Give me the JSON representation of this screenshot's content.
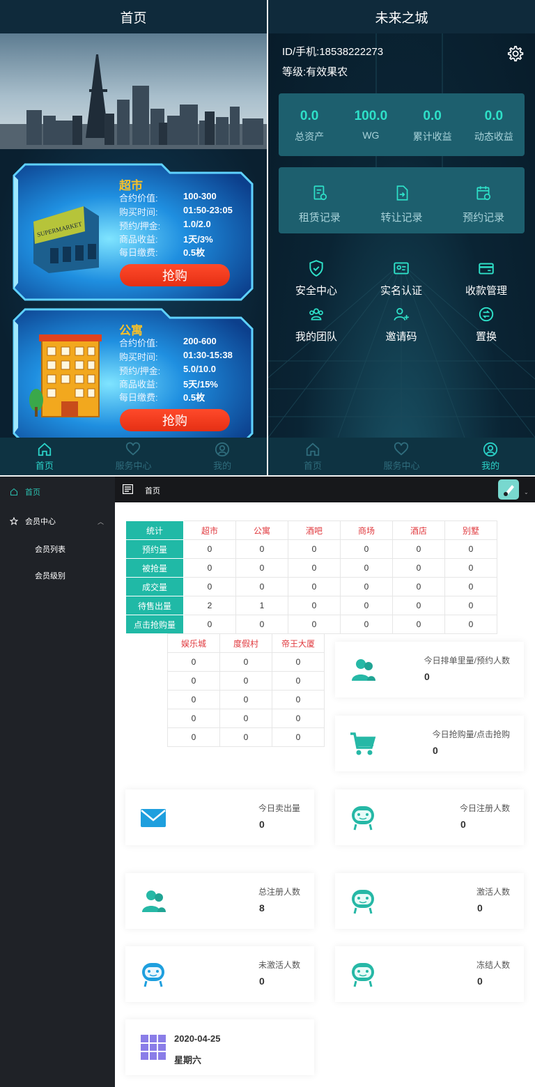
{
  "left_phone": {
    "title": "首页",
    "cards": [
      {
        "title": "超市",
        "sign_text": "SUPERMARKET",
        "rows": [
          {
            "k": "合约价值:",
            "v": "100-300"
          },
          {
            "k": "购买时间:",
            "v": "01:50-23:05"
          },
          {
            "k": "预约/押金:",
            "v": "1.0/2.0"
          },
          {
            "k": "商品收益:",
            "v": "1天/3%"
          },
          {
            "k": "每日缴费:",
            "v": "0.5枚"
          }
        ],
        "button": "抢购"
      },
      {
        "title": "公寓",
        "rows": [
          {
            "k": "合约价值:",
            "v": "200-600"
          },
          {
            "k": "购买时间:",
            "v": "01:30-15:38"
          },
          {
            "k": "预约/押金:",
            "v": "5.0/10.0"
          },
          {
            "k": "商品收益:",
            "v": "5天/15%"
          },
          {
            "k": "每日缴费:",
            "v": "0.5枚"
          }
        ],
        "button": "抢购"
      }
    ],
    "tabs": [
      "首页",
      "服务中心",
      "我的"
    ]
  },
  "right_phone": {
    "title": "未来之城",
    "id_line": "ID/手机:18538222273",
    "level_line": "等级:有效果农",
    "stats": [
      {
        "num": "0.0",
        "label": "总资产"
      },
      {
        "num": "100.0",
        "label": "WG"
      },
      {
        "num": "0.0",
        "label": "累计收益"
      },
      {
        "num": "0.0",
        "label": "动态收益"
      }
    ],
    "records": [
      "租赁记录",
      "转让记录",
      "预约记录"
    ],
    "menu": [
      "安全中心",
      "实名认证",
      "收款管理",
      "我的团队",
      "邀请码",
      "置换"
    ],
    "tabs": [
      "首页",
      "服务中心",
      "我的"
    ]
  },
  "admin": {
    "sidebar": {
      "home": "首页",
      "member_center": "会员中心",
      "member_list": "会员列表",
      "member_level": "会员级别"
    },
    "topbar_title": "首页",
    "table1": {
      "headers": [
        "统计",
        "超市",
        "公寓",
        "酒吧",
        "商场",
        "酒店",
        "别墅"
      ],
      "rows": [
        {
          "label": "预约量",
          "values": [
            "0",
            "0",
            "0",
            "0",
            "0",
            "0"
          ]
        },
        {
          "label": "被抢量",
          "values": [
            "0",
            "0",
            "0",
            "0",
            "0",
            "0"
          ]
        },
        {
          "label": "成交量",
          "values": [
            "0",
            "0",
            "0",
            "0",
            "0",
            "0"
          ]
        },
        {
          "label": "待售出量",
          "values": [
            "2",
            "1",
            "0",
            "0",
            "0",
            "0"
          ]
        },
        {
          "label": "点击抢购量",
          "values": [
            "0",
            "0",
            "0",
            "0",
            "0",
            "0"
          ]
        }
      ]
    },
    "table2": {
      "headers": [
        "娱乐城",
        "度假村",
        "帝王大厦"
      ],
      "rows": [
        [
          "0",
          "0",
          "0"
        ],
        [
          "0",
          "0",
          "0"
        ],
        [
          "0",
          "0",
          "0"
        ],
        [
          "0",
          "0",
          "0"
        ],
        [
          "0",
          "0",
          "0"
        ]
      ]
    },
    "kpis": {
      "queue": {
        "label": "今日排单里量/预约人数",
        "value": "0",
        "icon": "users-icon"
      },
      "grab": {
        "label": "今日抢购量/点击抢购",
        "value": "0",
        "icon": "cart-icon"
      },
      "sold": {
        "label": "今日卖出量",
        "value": "0",
        "icon": "mail-icon"
      },
      "today_reg": {
        "label": "今日注册人数",
        "value": "0",
        "icon": "face-icon"
      },
      "total_reg": {
        "label": "总注册人数",
        "value": "8",
        "icon": "users-icon"
      },
      "activated": {
        "label": "激活人数",
        "value": "0",
        "icon": "face-icon"
      },
      "inactive": {
        "label": "未激活人数",
        "value": "0",
        "icon": "face-icon"
      },
      "frozen": {
        "label": "冻结人数",
        "value": "0",
        "icon": "face-icon"
      }
    },
    "date": {
      "date": "2020-04-25",
      "weekday": "星期六"
    },
    "colors": {
      "teal": "#20b9a6",
      "blue": "#1e9fde",
      "purple": "#8a7de8",
      "red_header": "#e0393e"
    }
  }
}
